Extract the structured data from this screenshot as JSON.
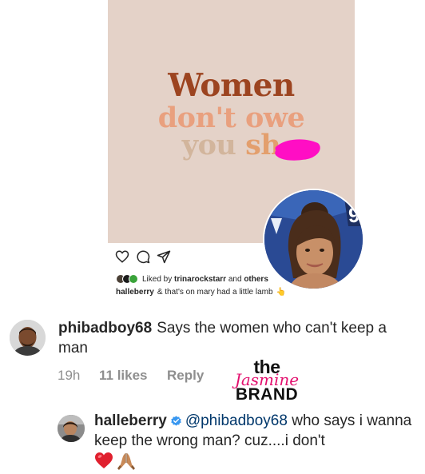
{
  "post": {
    "quote_line_1": "Women",
    "quote_line_2": "don't owe",
    "quote_line_3_word": "you ",
    "quote_line_3_last": "sh",
    "liked_prefix": "Liked by ",
    "liked_user": "trinarockstarr",
    "liked_suffix": " and ",
    "liked_others": "others",
    "caption_user": "halleberry",
    "caption_text": "& that's on mary had a little lamb",
    "caption_emoji": "👆"
  },
  "comments": [
    {
      "username": "phibadboy68",
      "text": "Says the women who can't keep a man",
      "time": "19h",
      "likes": "11 likes",
      "reply": "Reply"
    },
    {
      "username": "halleberry",
      "mention": "@phibadboy68",
      "text": " who says i wanna keep the wrong man?  cuz....i don't",
      "emojis": [
        "❤️",
        "🙏🏽"
      ]
    }
  ],
  "watermark": {
    "the": "the",
    "jasmine": "Jasmine",
    "brand": "BRAND"
  },
  "colors": {
    "post_bg": "#e4d2c8",
    "quote_1": "#9c4420",
    "quote_2": "#e9a07e",
    "quote_3": "#d2b59c",
    "censor": "#ff0ec4",
    "verified": "#3897f0",
    "watermark_pink": "#e3106e"
  },
  "icons": [
    "heart-icon",
    "comment-icon",
    "share-icon",
    "verified-badge-icon",
    "pointing-up-emoji"
  ]
}
